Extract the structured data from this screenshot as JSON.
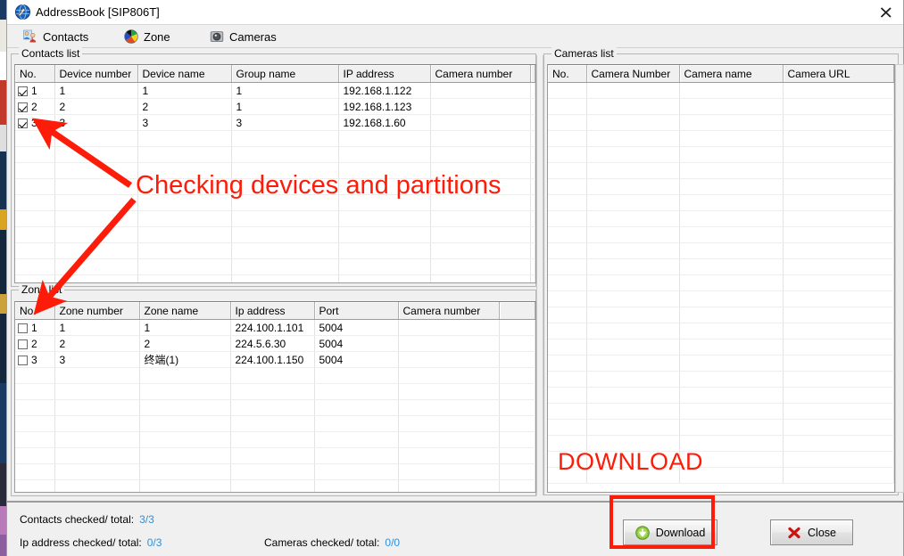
{
  "window": {
    "title": "AddressBook [SIP806T]",
    "app_icon": "globe-tools-icon",
    "close_icon": "close-icon"
  },
  "toolbar": {
    "items": [
      {
        "label": "Contacts",
        "icon": "contacts-people-icon"
      },
      {
        "label": "Zone",
        "icon": "zone-color-wheel-icon"
      },
      {
        "label": "Cameras",
        "icon": "camera-lens-icon"
      }
    ]
  },
  "contacts_panel": {
    "legend": "Contacts list",
    "columns": [
      "No.",
      "Device number",
      "Device name",
      "Group name",
      "IP address",
      "Camera number",
      ""
    ],
    "rows": [
      {
        "checked": true,
        "no": "1",
        "device_number": "1",
        "device_name": "1",
        "group_name": "1",
        "ip_address": "192.168.1.122",
        "camera_number": ""
      },
      {
        "checked": true,
        "no": "2",
        "device_number": "2",
        "device_name": "2",
        "group_name": "1",
        "ip_address": "192.168.1.123",
        "camera_number": ""
      },
      {
        "checked": true,
        "no": "3",
        "device_number": "3",
        "device_name": "3",
        "group_name": "3",
        "ip_address": "192.168.1.60",
        "camera_number": ""
      }
    ]
  },
  "zone_panel": {
    "legend": "Zone list",
    "columns": [
      "No.",
      "Zone number",
      "Zone name",
      "Ip address",
      "Port",
      "Camera number",
      ""
    ],
    "rows": [
      {
        "checked": false,
        "no": "1",
        "zone_number": "1",
        "zone_name": "1",
        "ip_address": "224.100.1.101",
        "port": "5004",
        "camera_number": ""
      },
      {
        "checked": false,
        "no": "2",
        "zone_number": "2",
        "zone_name": "2",
        "ip_address": "224.5.6.30",
        "port": "5004",
        "camera_number": ""
      },
      {
        "checked": false,
        "no": "3",
        "zone_number": "3",
        "zone_name": "终端(1)",
        "ip_address": "224.100.1.150",
        "port": "5004",
        "camera_number": ""
      }
    ]
  },
  "cameras_panel": {
    "legend": "Cameras list",
    "columns": [
      "No.",
      "Camera Number",
      "Camera name",
      "Camera URL",
      ""
    ],
    "rows": []
  },
  "status": {
    "contacts_label": "Contacts checked/ total:",
    "contacts_value": "3/3",
    "ip_label": "Ip address checked/ total:",
    "ip_value": "0/3",
    "cameras_label": "Cameras checked/ total:",
    "cameras_value": "0/0",
    "value_color": "#2f8fd8"
  },
  "buttons": {
    "download": {
      "label": "Download",
      "icon": "download-arrow-icon"
    },
    "close": {
      "label": "Close",
      "icon": "red-x-icon"
    }
  },
  "annotations": {
    "checking_text": "Checking devices and partitions",
    "download_text": "DOWNLOAD",
    "color": "#fc1c09"
  }
}
